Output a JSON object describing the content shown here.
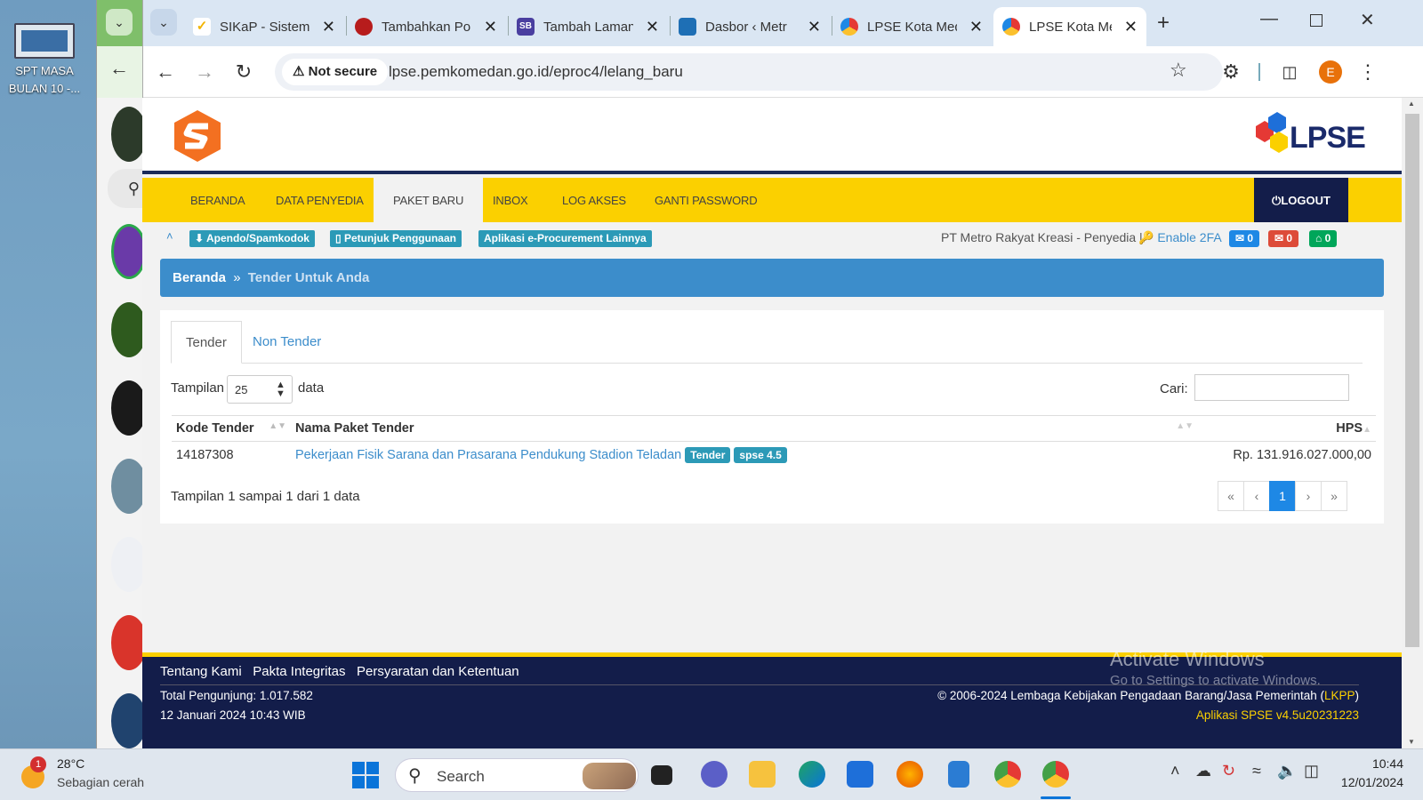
{
  "desktop": {
    "icon_label": "SPT MASA BULAN 10 -..."
  },
  "browser": {
    "tabs": [
      {
        "title": "SIKaP - Sistem",
        "color": "#f2b400"
      },
      {
        "title": "Tambahkan Po",
        "color": "#b71c1c"
      },
      {
        "title": "Tambah Laman",
        "color": "#4a3fa0"
      },
      {
        "title": "Dasbor ‹ Metr",
        "color": "#1e6fb5"
      },
      {
        "title": "LPSE Kota Med",
        "color": "#e53935"
      },
      {
        "title": "LPSE Kota Med",
        "color": "#e53935"
      }
    ],
    "security_label": "Not secure",
    "url": "lpse.pemkomedan.go.id/eproc4/lelang_baru",
    "profile_initial": "E"
  },
  "site": {
    "logo_text": "LPSE",
    "nav": [
      {
        "label": "BERANDA"
      },
      {
        "label": "DATA PENYEDIA"
      },
      {
        "label": "PAKET BARU"
      },
      {
        "label": "INBOX"
      },
      {
        "label": "LOG AKSES"
      },
      {
        "label": "GANTI PASSWORD"
      }
    ],
    "logout_label": "LOGOUT",
    "sub_buttons": [
      "Apendo/Spamkodok",
      "Petunjuk Penggunaan",
      "Aplikasi e-Procurement Lainnya"
    ],
    "user_info": "PT Metro Rakyat Kreasi - Penyedia |",
    "enable_2fa": "Enable 2FA",
    "badges": [
      "0",
      "0",
      "0"
    ],
    "breadcrumb": {
      "home": "Beranda",
      "sep": "»",
      "current": "Tender Untuk Anda"
    },
    "tabs": [
      "Tender",
      "Non Tender"
    ],
    "length_prefix": "Tampilan",
    "length_value": "25",
    "length_suffix": "data",
    "search_label": "Cari:",
    "columns": [
      "Kode Tender",
      "Nama Paket Tender",
      "HPS"
    ],
    "rows": [
      {
        "kode": "14187308",
        "nama": "Pekerjaan Fisik Sarana dan Prasarana Pendukung Stadion Teladan",
        "label1": "Tender",
        "label2": "spse 4.5",
        "hps": "Rp. 131.916.027.000,00"
      }
    ],
    "info": "Tampilan 1 sampai 1 dari 1 data",
    "pager": [
      "«",
      "‹",
      "1",
      "›",
      "»"
    ],
    "footer": {
      "links": [
        "Tentang Kami",
        "Pakta Integritas",
        "Persyaratan dan Ketentuan"
      ],
      "visitors": "Total Pengunjung: 1.017.582",
      "datetime": "12 Januari 2024 10:43 WIB",
      "copyright_pre": "© 2006-2024 Lembaga Kebijakan Pengadaan Barang/Jasa Pemerintah (",
      "copyright_link": "LKPP",
      "copyright_post": ")",
      "version": "Aplikasi SPSE v4.5u20231223"
    },
    "watermark": {
      "line1": "Activate Windows",
      "line2": "Go to Settings to activate Windows."
    }
  },
  "taskbar": {
    "weather_badge": "1",
    "temperature": "28°C",
    "weather": "Sebagian cerah",
    "search_placeholder": "Search",
    "time": "10:44",
    "date": "12/01/2024"
  }
}
